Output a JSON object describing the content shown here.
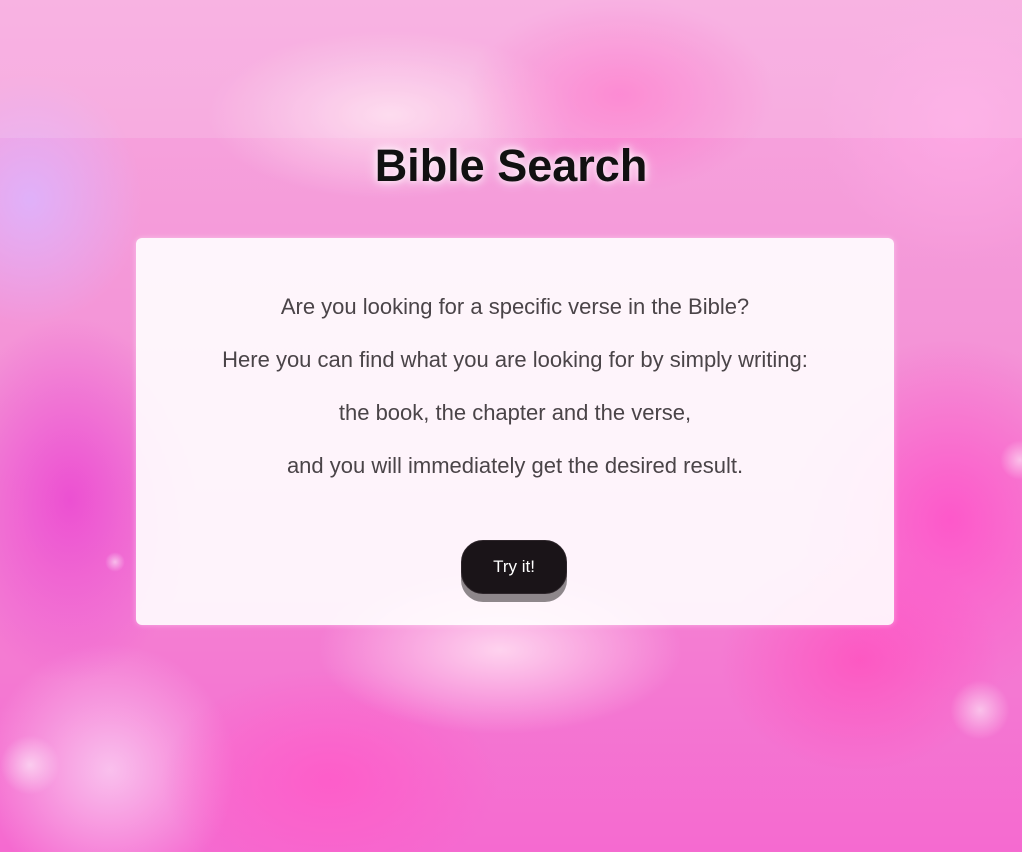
{
  "page": {
    "title": "Bible Search"
  },
  "intro": {
    "line1": "Are you looking for a specific verse in the Bible?",
    "line2": "Here you can find what you are looking for by simply writing:",
    "line3": "the book, the chapter and the verse,",
    "line4": "and you will immediately get the desired result."
  },
  "cta": {
    "label": "Try it!"
  },
  "colors": {
    "background": "#f48fd6",
    "button": "#1a1418",
    "text": "#4a4448"
  }
}
